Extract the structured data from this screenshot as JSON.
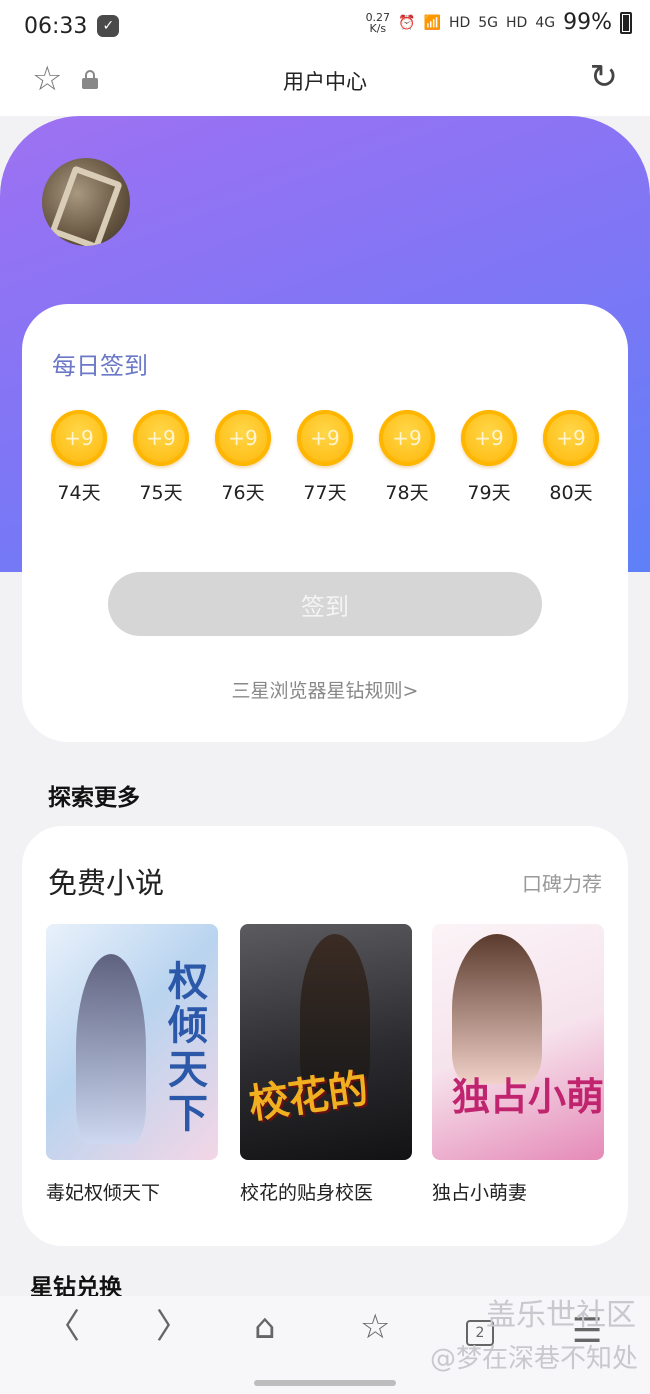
{
  "status_bar": {
    "time": "06:33",
    "speed": "0.27",
    "speed_unit": "K/s",
    "network_1": "HD",
    "network_1_gen": "5G",
    "network_2": "HD",
    "network_2_gen": "4G",
    "battery": "99%"
  },
  "browser": {
    "page_title": "用户中心"
  },
  "checkin": {
    "title": "每日签到",
    "days": [
      {
        "reward": "+9",
        "label": "74天"
      },
      {
        "reward": "+9",
        "label": "75天"
      },
      {
        "reward": "+9",
        "label": "76天"
      },
      {
        "reward": "+9",
        "label": "77天"
      },
      {
        "reward": "+9",
        "label": "78天"
      },
      {
        "reward": "+9",
        "label": "79天"
      },
      {
        "reward": "+9",
        "label": "80天"
      }
    ],
    "button_label": "签到",
    "rules_link": "三星浏览器星钻规则>"
  },
  "explore": {
    "title": "探索更多",
    "card": {
      "title": "免费小说",
      "subtitle": "口碑力荐",
      "books": [
        {
          "title": "毒妃权倾天下",
          "cover_text": "权倾天下"
        },
        {
          "title": "校花的贴身校医",
          "cover_text": "校花的"
        },
        {
          "title": "独占小萌妻",
          "cover_text": "独占小萌妻"
        }
      ]
    }
  },
  "exchange": {
    "title": "星钻兑换"
  },
  "bottom_nav": {
    "tab_count": "2"
  },
  "watermark": {
    "line1": "盖乐世社区",
    "line2": "@梦在深巷不知处"
  },
  "colors": {
    "gradient_start": "#9e71f2",
    "gradient_end": "#5f80f8",
    "checkin_title": "#6b78c8",
    "coin": "#ffc21e"
  }
}
